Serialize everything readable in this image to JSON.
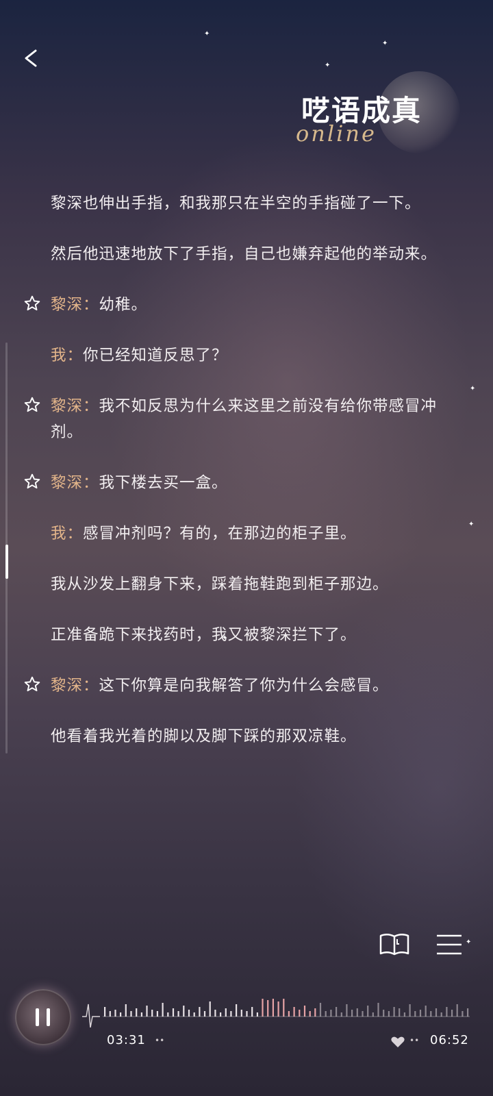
{
  "header": {
    "logo_title": "呓语成真",
    "logo_subtitle": "online"
  },
  "story": {
    "lines": [
      {
        "speaker": "",
        "text": "黎深也伸出手指，和我那只在半空的手指碰了一下。",
        "star": false
      },
      {
        "speaker": "",
        "text": "然后他迅速地放下了手指，自己也嫌弃起他的举动来。",
        "star": false
      },
      {
        "speaker": "黎深：",
        "text": "幼稚。",
        "star": true
      },
      {
        "speaker": "我：",
        "text": "你已经知道反思了？",
        "star": false
      },
      {
        "speaker": "黎深：",
        "text": "我不如反思为什么来这里之前没有给你带感冒冲剂。",
        "star": true
      },
      {
        "speaker": "黎深：",
        "text": "我下楼去买一盒。",
        "star": true
      },
      {
        "speaker": "我：",
        "text": "感冒冲剂吗？有的，在那边的柜子里。",
        "star": false
      },
      {
        "speaker": "",
        "text": "我从沙发上翻身下来，踩着拖鞋跑到柜子那边。",
        "star": false
      },
      {
        "speaker": "",
        "text": "正准备跪下来找药时，我又被黎深拦下了。",
        "star": false
      },
      {
        "speaker": "黎深：",
        "text": "这下你算是向我解答了你为什么会感冒。",
        "star": true
      },
      {
        "speaker": "",
        "text": "他看着我光着的脚以及脚下踩的那双凉鞋。",
        "star": false
      }
    ]
  },
  "toolbar": {
    "book_icon": "book-icon",
    "menu_icon": "menu-icon"
  },
  "player": {
    "current_time": "03:31",
    "total_time": "06:52",
    "progress": 0.51,
    "state": "playing",
    "icons": [
      "pause-icon",
      "heart-icon",
      "dots-icon"
    ]
  },
  "colors": {
    "speaker": "#e3b58a",
    "text": "#f2eef0",
    "wave_played": "#e7a3a6",
    "wave_unplayed": "#c9c3c8"
  }
}
